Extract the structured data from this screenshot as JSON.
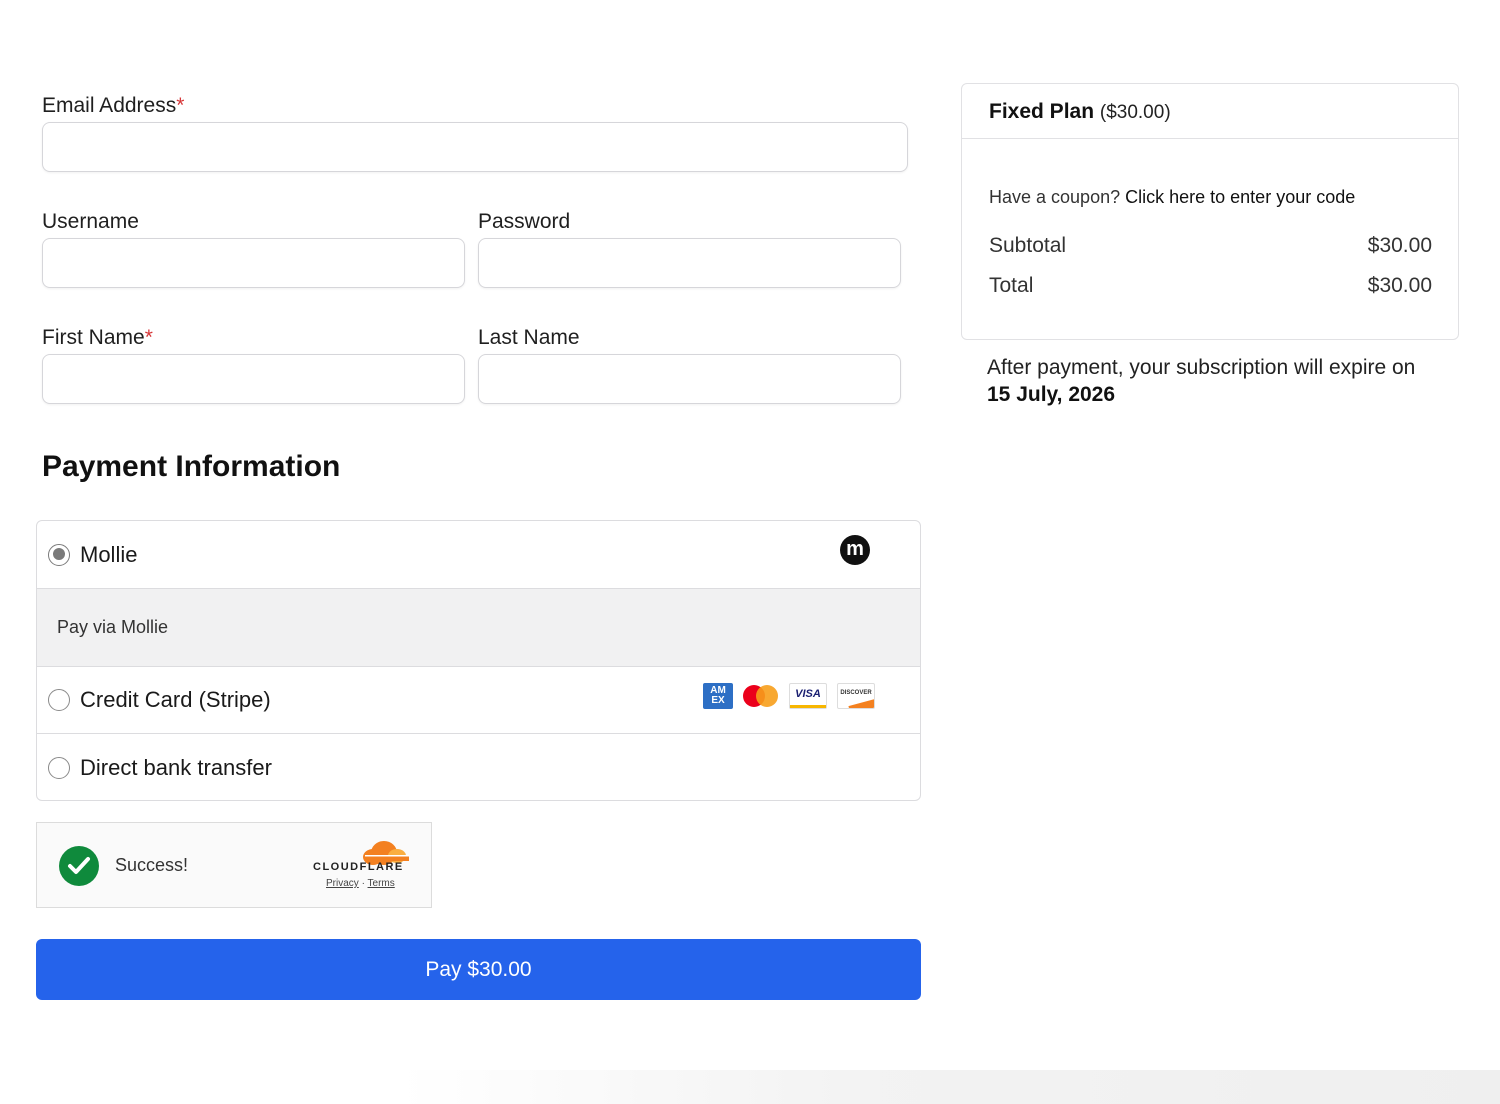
{
  "form": {
    "email_label": "Email Address",
    "email_value": "",
    "username_label": "Username",
    "username_value": "",
    "password_label": "Password",
    "password_value": "",
    "first_name_label": "First Name",
    "first_name_value": "",
    "last_name_label": "Last Name",
    "last_name_value": "",
    "required_marker": "*"
  },
  "payment": {
    "title": "Payment Information",
    "methods": [
      {
        "label": "Mollie",
        "selected": true,
        "description": "Pay via Mollie",
        "icon": "mollie-logo",
        "logo_text": "m"
      },
      {
        "label": "Credit Card (Stripe)",
        "selected": false,
        "icons": [
          "amex-icon",
          "mastercard-icon",
          "visa-icon",
          "discover-icon"
        ],
        "amex_text": "AM EX",
        "visa_text": "VISA",
        "discover_text": "DISCOVER"
      },
      {
        "label": "Direct bank transfer",
        "selected": false
      }
    ]
  },
  "captcha": {
    "status": "Success!",
    "provider": "CLOUDFLARE",
    "privacy_label": "Privacy",
    "separator": "·",
    "terms_label": "Terms",
    "check_color": "#0f8a3c"
  },
  "pay_button": {
    "label": "Pay $30.00",
    "color": "#2563eb"
  },
  "summary": {
    "plan_name": "Fixed Plan",
    "plan_price": "($30.00)",
    "coupon_prompt": "Have a coupon?",
    "coupon_link": "Click here to enter your code",
    "subtotal_label": "Subtotal",
    "subtotal_value": "$30.00",
    "total_label": "Total",
    "total_value": "$30.00",
    "expiry_text": "After payment, your subscription will expire on",
    "expiry_date": "15 July, 2026"
  }
}
